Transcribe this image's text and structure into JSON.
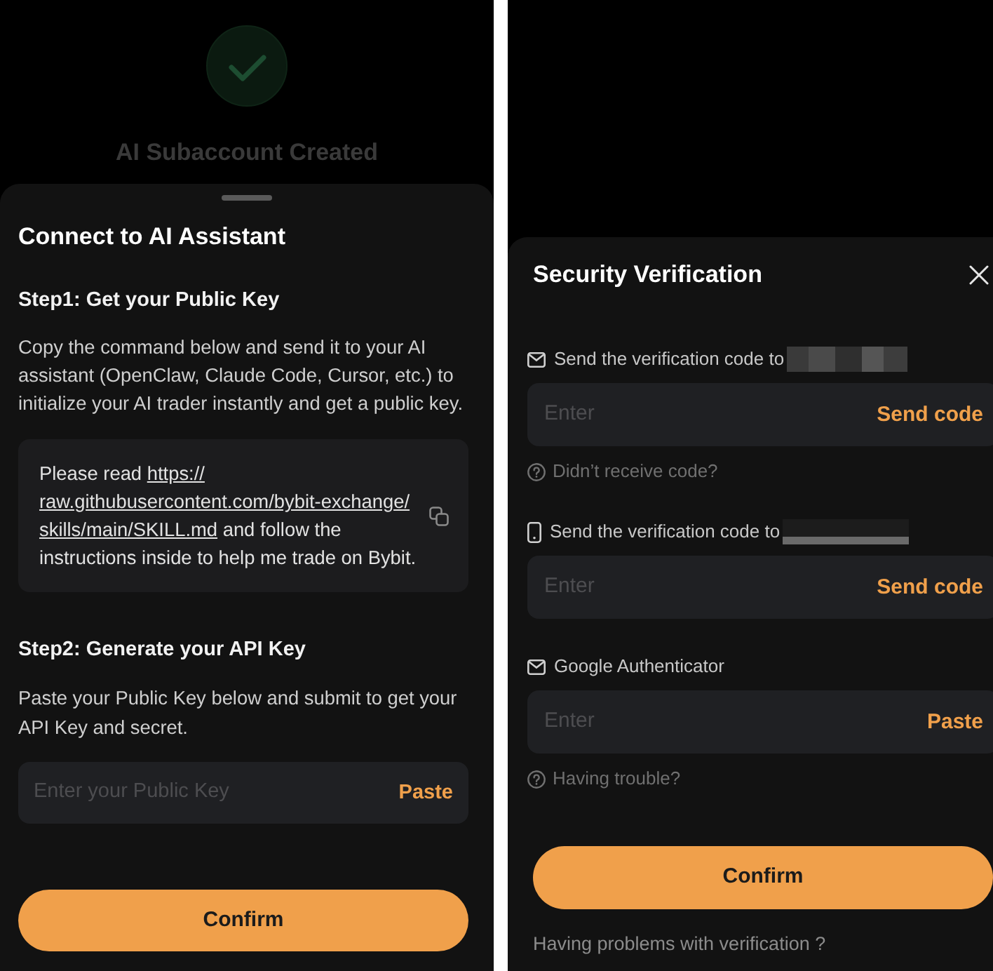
{
  "connect_screen": {
    "backdrop": {
      "title": "AI Subaccount Created"
    },
    "sheet": {
      "title": "Connect to AI Assistant",
      "steps": [
        {
          "kind": "command",
          "heading": "Step1: Get your Public Key",
          "description": "Copy the command below and send it to your AI assistant (OpenClaw, Claude Code, Cursor, etc.) to initialize your AI trader instantly and get a public key.",
          "command": {
            "before": "Please read",
            "link": [
              "https://",
              "raw.githubusercontent.com/bybit-exchange/",
              "skills/main/SKILL.md"
            ],
            "after": "and follow the instructions inside to help me trade on Bybit."
          }
        },
        {
          "kind": "field",
          "heading": "Step2: Generate your API Key",
          "description": "Paste your Public Key below and submit to get your API Key and secret.",
          "field": {
            "placeholder": "Enter your Public Key",
            "action": "Paste"
          }
        }
      ],
      "confirm_button": "Confirm"
    }
  },
  "verification_screen": {
    "title": "Security Verification",
    "methods": [
      {
        "kind": "email",
        "label": "Send the verification code to",
        "masked": true,
        "field": {
          "placeholder": "Enter",
          "action": "Send code"
        },
        "help": "Didn’t receive code?"
      },
      {
        "kind": "phone",
        "label": "Send the verification code to",
        "masked": true,
        "field": {
          "placeholder": "Enter",
          "action": "Send code"
        }
      },
      {
        "kind": "authenticator",
        "label": "Google Authenticator",
        "field": {
          "placeholder": "Enter",
          "action": "Paste"
        },
        "help": "Having trouble?"
      }
    ],
    "confirm_button": "Confirm",
    "footer_link": "Having problems with verification ?"
  }
}
